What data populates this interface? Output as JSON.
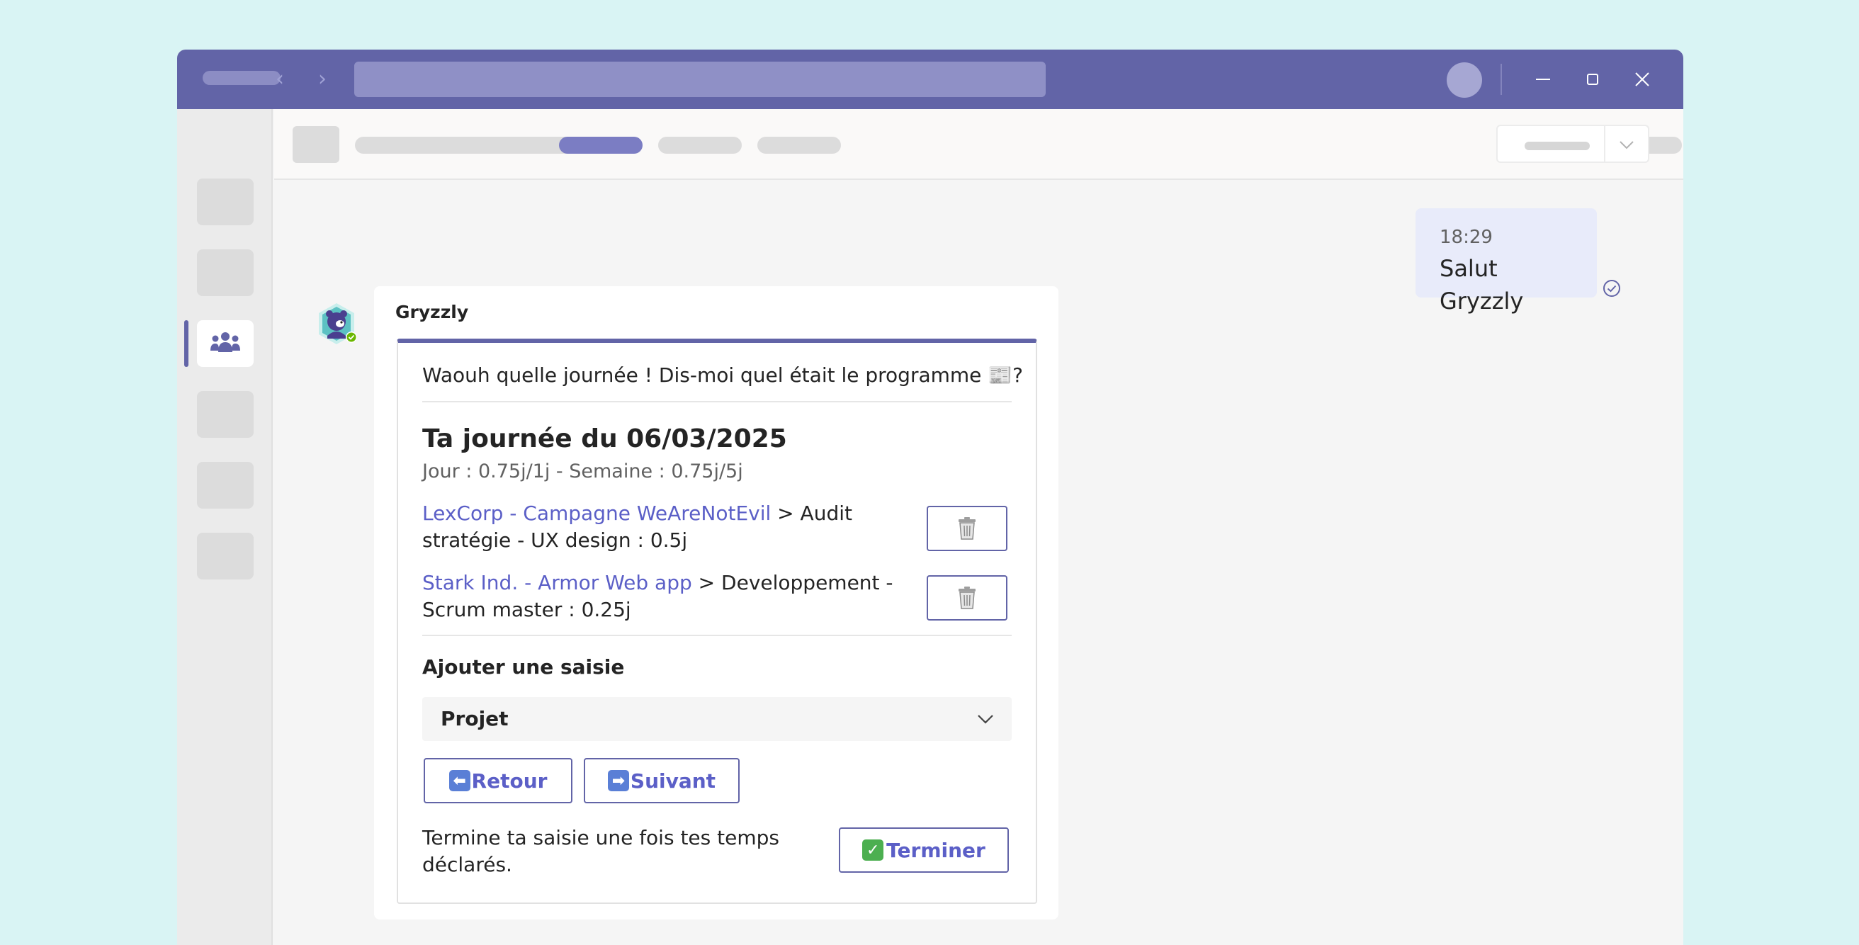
{
  "colors": {
    "brand": "#6264a7",
    "link": "#5b5fc7",
    "background": "#d9f4f4",
    "own_bubble": "#e8ebfa"
  },
  "own_message": {
    "time": "18:29",
    "text": "Salut Gryzzly",
    "status_icon": "read-receipt-icon"
  },
  "bot_message": {
    "sender": "Gryzzly",
    "avatar_icon": "bear-avatar-icon",
    "card": {
      "intro": "Waouh quelle journée ! Dis-moi quel était le programme 📰?",
      "title": "Ta journée du 06/03/2025",
      "subtitle": "Jour : 0.75j/1j - Semaine : 0.75j/5j",
      "entries": [
        {
          "project": "LexCorp - Campagne WeAreNotEvil",
          "detail": " > Audit stratégie - UX design : 0.5j",
          "delete_icon": "trash-icon"
        },
        {
          "project": "Stark Ind. - Armor Web app",
          "detail": " > Developpement - Scrum master : 0.25j",
          "delete_icon": "trash-icon"
        }
      ],
      "add_label": "Ajouter une saisie",
      "select": {
        "value": "Projet"
      },
      "back_label": "Retour",
      "next_label": "Suivant",
      "finish_text": "Termine ta saisie une fois tes temps déclarés.",
      "finish_label": "Terminer"
    }
  }
}
